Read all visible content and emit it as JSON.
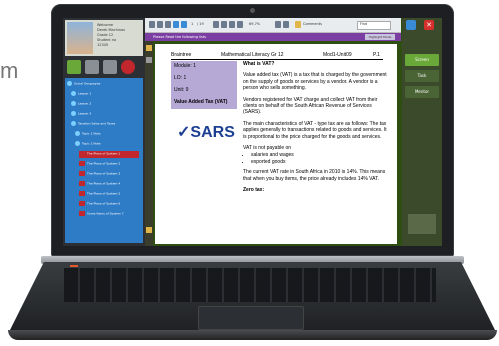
{
  "edge_text": "m",
  "user": {
    "line1": "Welcome",
    "line2": "Derek Machinos",
    "line3": "Grade 12",
    "line4": "Student no",
    "line5": "12345"
  },
  "tree": {
    "items": [
      {
        "label": "Social Geography"
      },
      {
        "label": "Lesson 1"
      },
      {
        "label": "Lesson 2"
      },
      {
        "label": "Lesson 3"
      },
      {
        "label": "Taxation Sales and Taxes"
      },
      {
        "label": "Topic 1 Note"
      },
      {
        "label": "Topic 2 Note"
      },
      {
        "label": "The Plans of System 1"
      },
      {
        "label": "The Plans of System 2"
      },
      {
        "label": "The Plans of System 3"
      },
      {
        "label": "The Plans of System 4"
      },
      {
        "label": "The Plans of System 5"
      },
      {
        "label": "The Plans of System 6"
      },
      {
        "label": "Some Items of System 7"
      }
    ]
  },
  "toolbar": {
    "page": "1",
    "of": "/ 19",
    "zoom": "69.7%",
    "comments": "Comments",
    "find": "Find"
  },
  "note_bar": {
    "text": "Please Read the following lists",
    "button": "Highlight Mode"
  },
  "document": {
    "school": "Braintree",
    "subject": "Mathematical Literacy Gr 12",
    "module_code": "Mod1-Unit09",
    "page": "P.1",
    "box": {
      "module": "Module: 1",
      "lo": "LO: 1",
      "unit": "Unit: 9",
      "topic": "Value Added Tax (VAT)"
    },
    "logo_text": "SARS",
    "heading": "What is VAT?",
    "para1": "Value added tax (VAT) is a tax that is charged by the government on the supply of goods or services by a vendor. A vendor is a person who sells something.",
    "para2": "Vendors registered for VAT charge and collect VAT from their clients on behalf of the South African Revenue of Services (SARS).",
    "para3": "The main characteristics of VAT - type tax are as follows: The tax applies generally to transactions related to goods and services. It is proportional to the price charged for the goods and services.",
    "para4": "VAT is not payable on",
    "bullets": [
      "salaries and wages",
      "exported goods"
    ],
    "para5": "The current VAT rate in South Africa in 2010 is 14%. This means that when you buy items, the price already includes 14% VAT.",
    "para6": "Zero tax:"
  },
  "right_panel": {
    "screen_btn": "Screen",
    "task_btn": "Task",
    "mentor_btn": "Mentor"
  }
}
